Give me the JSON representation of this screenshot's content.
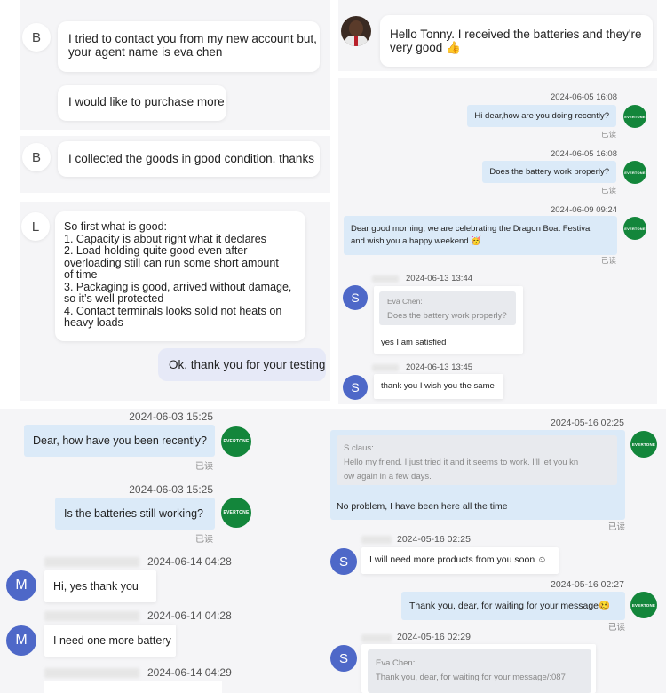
{
  "colors": {
    "panel_bg": "#f5f5f7",
    "bubble_blue": "#dbeaf8",
    "bubble_lavender": "#e6e9f7",
    "avatar_s": "#4e68c8",
    "brand_green": "#13863b"
  },
  "brand_label": "EVERTONE",
  "panel1": {
    "messages": [
      {
        "avatar": "B",
        "lines": [
          "I tried to contact you from my new account but,",
          "your agent name is eva chen"
        ]
      },
      {
        "lines": [
          "I would like to purchase more"
        ]
      }
    ]
  },
  "panel2": {
    "messages": [
      {
        "avatar": "B",
        "lines": [
          "I collected the goods in good condition. thanks"
        ]
      }
    ]
  },
  "panel3": {
    "messages": [
      {
        "avatar": "L",
        "lines": [
          "So first what is good:",
          "1. Capacity is about right what it declares",
          "2. Load holding quite good even after",
          "overloading still can run some short amount",
          "of time",
          "3. Packaging is good, arrived without damage,",
          "so it’s well protected",
          "4. Contact terminals looks solid not heats on",
          "heavy loads"
        ]
      },
      {
        "lines": [
          "Ok, thank you for your testing"
        ]
      }
    ]
  },
  "panel4": {
    "message": {
      "lines": [
        "Hello Tonny. I received the batteries and they're",
        "very good 👍"
      ]
    }
  },
  "panel5": {
    "messages": [
      {
        "time": "2024-06-05 16:08",
        "text": "Hi dear,how are you doing recently?",
        "status": "已读"
      },
      {
        "time": "2024-06-05 16:08",
        "text": "Does the battery work properly?",
        "status": "已读"
      },
      {
        "time": "2024-06-09 09:24",
        "lines": [
          "Dear good morning, we are celebrating the Dragon Boat Festival",
          "and wish you a happy weekend."
        ],
        "emoji": "🥳",
        "status": "已读"
      },
      {
        "time": "2024-06-13 13:44",
        "avatar": "S",
        "quote_name": "Eva Chen:",
        "quote_text": "Does the battery work properly?",
        "text": "yes I am satisfied"
      },
      {
        "time": "2024-06-13 13:45",
        "avatar": "S",
        "text": "thank you I wish you the same"
      }
    ]
  },
  "panel6": {
    "messages": [
      {
        "time": "2024-06-03 15:25",
        "text": "Dear, how have you been recently?",
        "status": "已读"
      },
      {
        "time": "2024-06-03 15:25",
        "text": "Is the batteries still working?",
        "status": "已读"
      },
      {
        "time": "2024-06-14 04:28",
        "avatar": "M",
        "text": "Hi, yes thank you"
      },
      {
        "time": "2024-06-14 04:28",
        "avatar": "M",
        "text": "I need one more battery"
      },
      {
        "time": "2024-06-14 04:29"
      }
    ]
  },
  "panel7": {
    "messages": [
      {
        "time": "2024-05-16 02:25",
        "quote_name": "S claus:",
        "quote_lines": [
          "Hello my friend. I just tried it and it seems to work. I'll let you kn",
          "ow again in a few days."
        ],
        "text": "No problem, I have been here all the time",
        "status": "已读"
      },
      {
        "time": "2024-05-16 02:25",
        "avatar": "S",
        "text": "I will need more products from you soon ☺"
      },
      {
        "time": "2024-05-16 02:27",
        "text": "Thank you, dear, for waiting for your message",
        "emoji": "🥴",
        "status": "已读"
      },
      {
        "time": "2024-05-16 02:29",
        "avatar": "S",
        "quote_name": "Eva Chen:",
        "quote_text": "Thank you, dear, for waiting for your message/:087"
      }
    ]
  }
}
